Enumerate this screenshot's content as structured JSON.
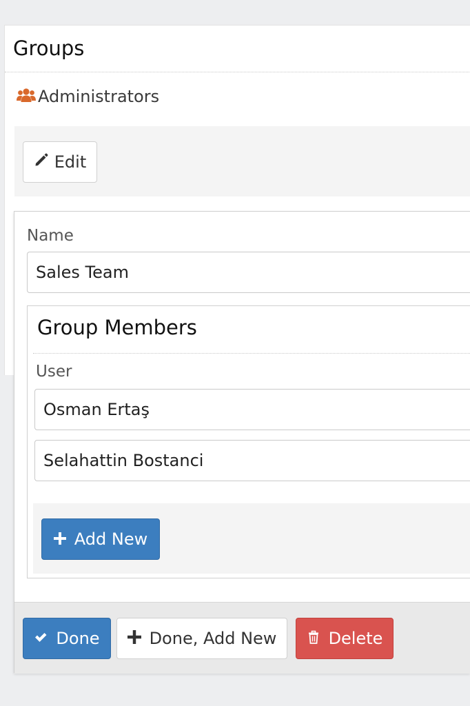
{
  "groups_panel": {
    "title": "Groups",
    "group_name": "Administrators",
    "group_icon": "users-icon",
    "edit_label": "Edit",
    "edit_icon": "pencil-icon"
  },
  "editor": {
    "name_label": "Name",
    "name_value": "Sales Team",
    "members": {
      "title": "Group Members",
      "user_label": "User",
      "users": [
        "Osman Ertaş",
        "Selahattin Bostanci"
      ],
      "add_label": "Add New"
    },
    "footer": {
      "done_label": "Done",
      "done_add_new_label": "Done, Add New",
      "delete_label": "Delete"
    }
  },
  "colors": {
    "primary": "#3c7ebf",
    "danger": "#d9534f",
    "group_icon": "#d9692c"
  }
}
